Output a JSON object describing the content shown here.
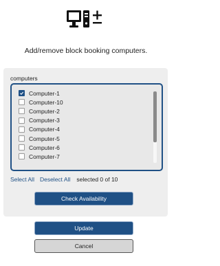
{
  "header": {
    "icon": "computer-add-remove-icon",
    "subtitle": "Add/remove block booking computers."
  },
  "panel": {
    "title": "computers",
    "items": [
      {
        "label": "Computer-1",
        "checked": true
      },
      {
        "label": "Computer-10",
        "checked": false
      },
      {
        "label": "Computer-2",
        "checked": false
      },
      {
        "label": "Computer-3",
        "checked": false
      },
      {
        "label": "Computer-4",
        "checked": false
      },
      {
        "label": "Computer-5",
        "checked": false
      },
      {
        "label": "Computer-6",
        "checked": false
      },
      {
        "label": "Computer-7",
        "checked": false
      }
    ],
    "select_all_label": "Select All",
    "deselect_all_label": "Deselect All",
    "selected_text": "selected 0 of 10",
    "check_availability_label": "Check Availability"
  },
  "footer": {
    "update_label": "Update",
    "cancel_label": "Cancel"
  },
  "colors": {
    "accent": "#1f5085",
    "panel_bg": "#eeeeee",
    "list_bg": "#e8e8e8"
  }
}
